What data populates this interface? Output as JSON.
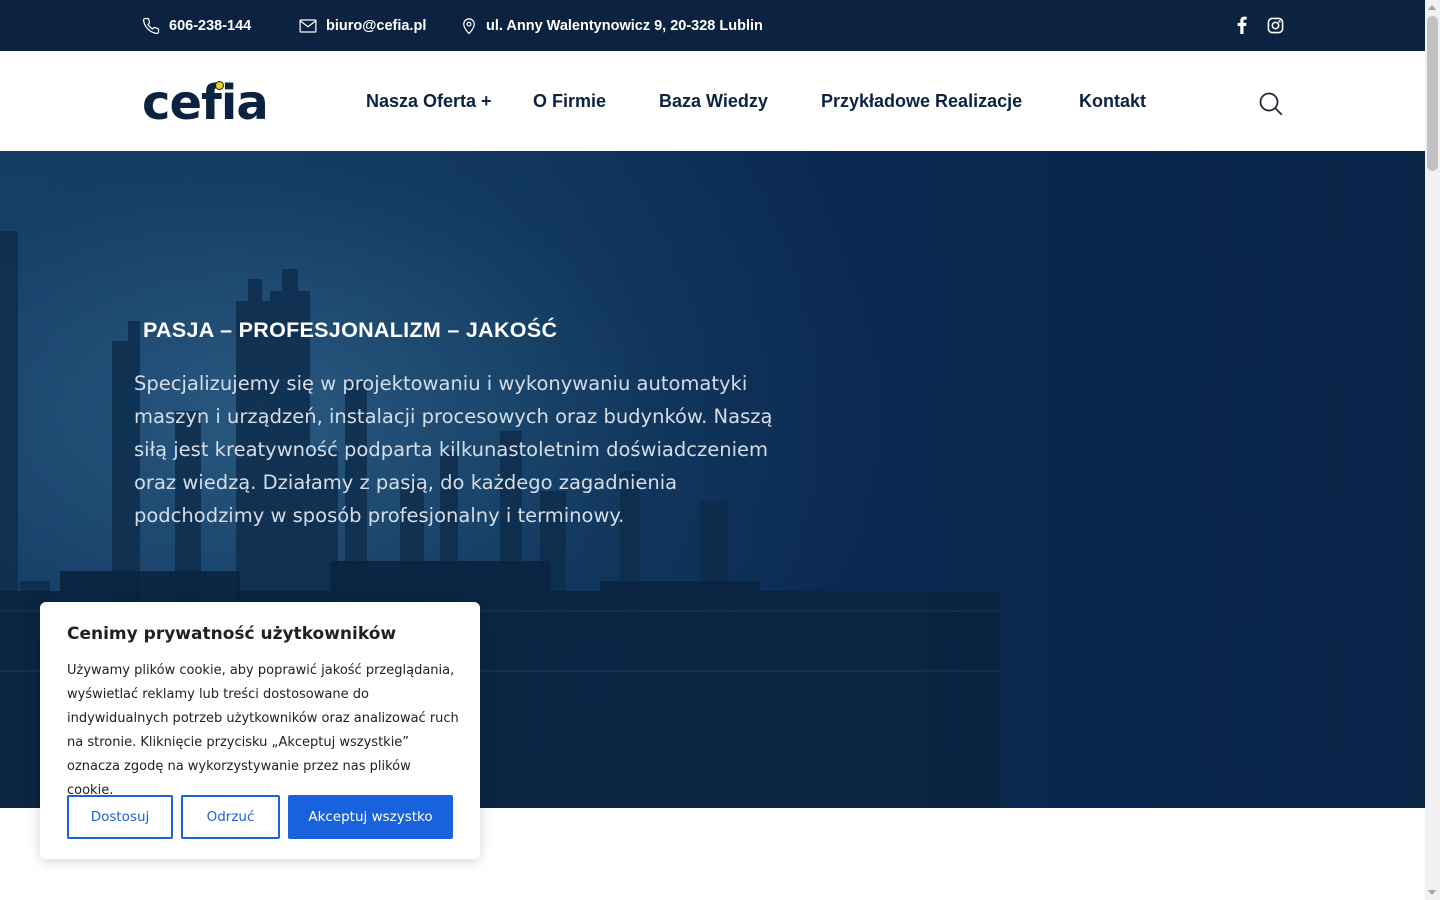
{
  "topbar": {
    "phone": "606-238-144",
    "email": "biuro@cefia.pl",
    "address": "ul. Anny Walentynowicz 9, 20-328 Lublin",
    "social": [
      "facebook-icon",
      "instagram-icon"
    ]
  },
  "header": {
    "logo": "cefia",
    "nav": [
      {
        "label": "Nasza Oferta +"
      },
      {
        "label": "O Firmie"
      },
      {
        "label": "Baza Wiedzy"
      },
      {
        "label": "Przykładowe Realizacje"
      },
      {
        "label": "Kontakt"
      }
    ],
    "search_icon": "search-icon"
  },
  "hero": {
    "heading": "PASJA – PROFESJONALIZM – JAKOŚĆ",
    "text": "Specjalizujemy się w projektowaniu i wykonywaniu automatyki maszyn i urządzeń, instalacji procesowych oraz budynków. Naszą siłą jest kreatywność podparta kilkunastoletnim doświadczeniem oraz wiedzą. Działamy z pasją, do każdego zagadnienia podchodzimy w sposób profesjonalny i terminowy."
  },
  "cookie": {
    "title": "Cenimy prywatność użytkowników",
    "body": "Używamy plików cookie, aby poprawić jakość przeglądania, wyświetlać reklamy lub treści dostosowane do indywidualnych potrzeb użytkowników oraz analizować ruch na stronie. Kliknięcie przycisku „Akceptuj wszystkie” oznacza zgodę na wykorzystywanie przez nas plików cookie.",
    "customize_label": "Dostosuj",
    "reject_label": "Odrzuć",
    "accept_label": "Akceptuj wszystko"
  },
  "colors": {
    "brand_navy": "#0b2341",
    "accent_blue": "#1863dc",
    "logo_dot": "#f3d21a"
  }
}
